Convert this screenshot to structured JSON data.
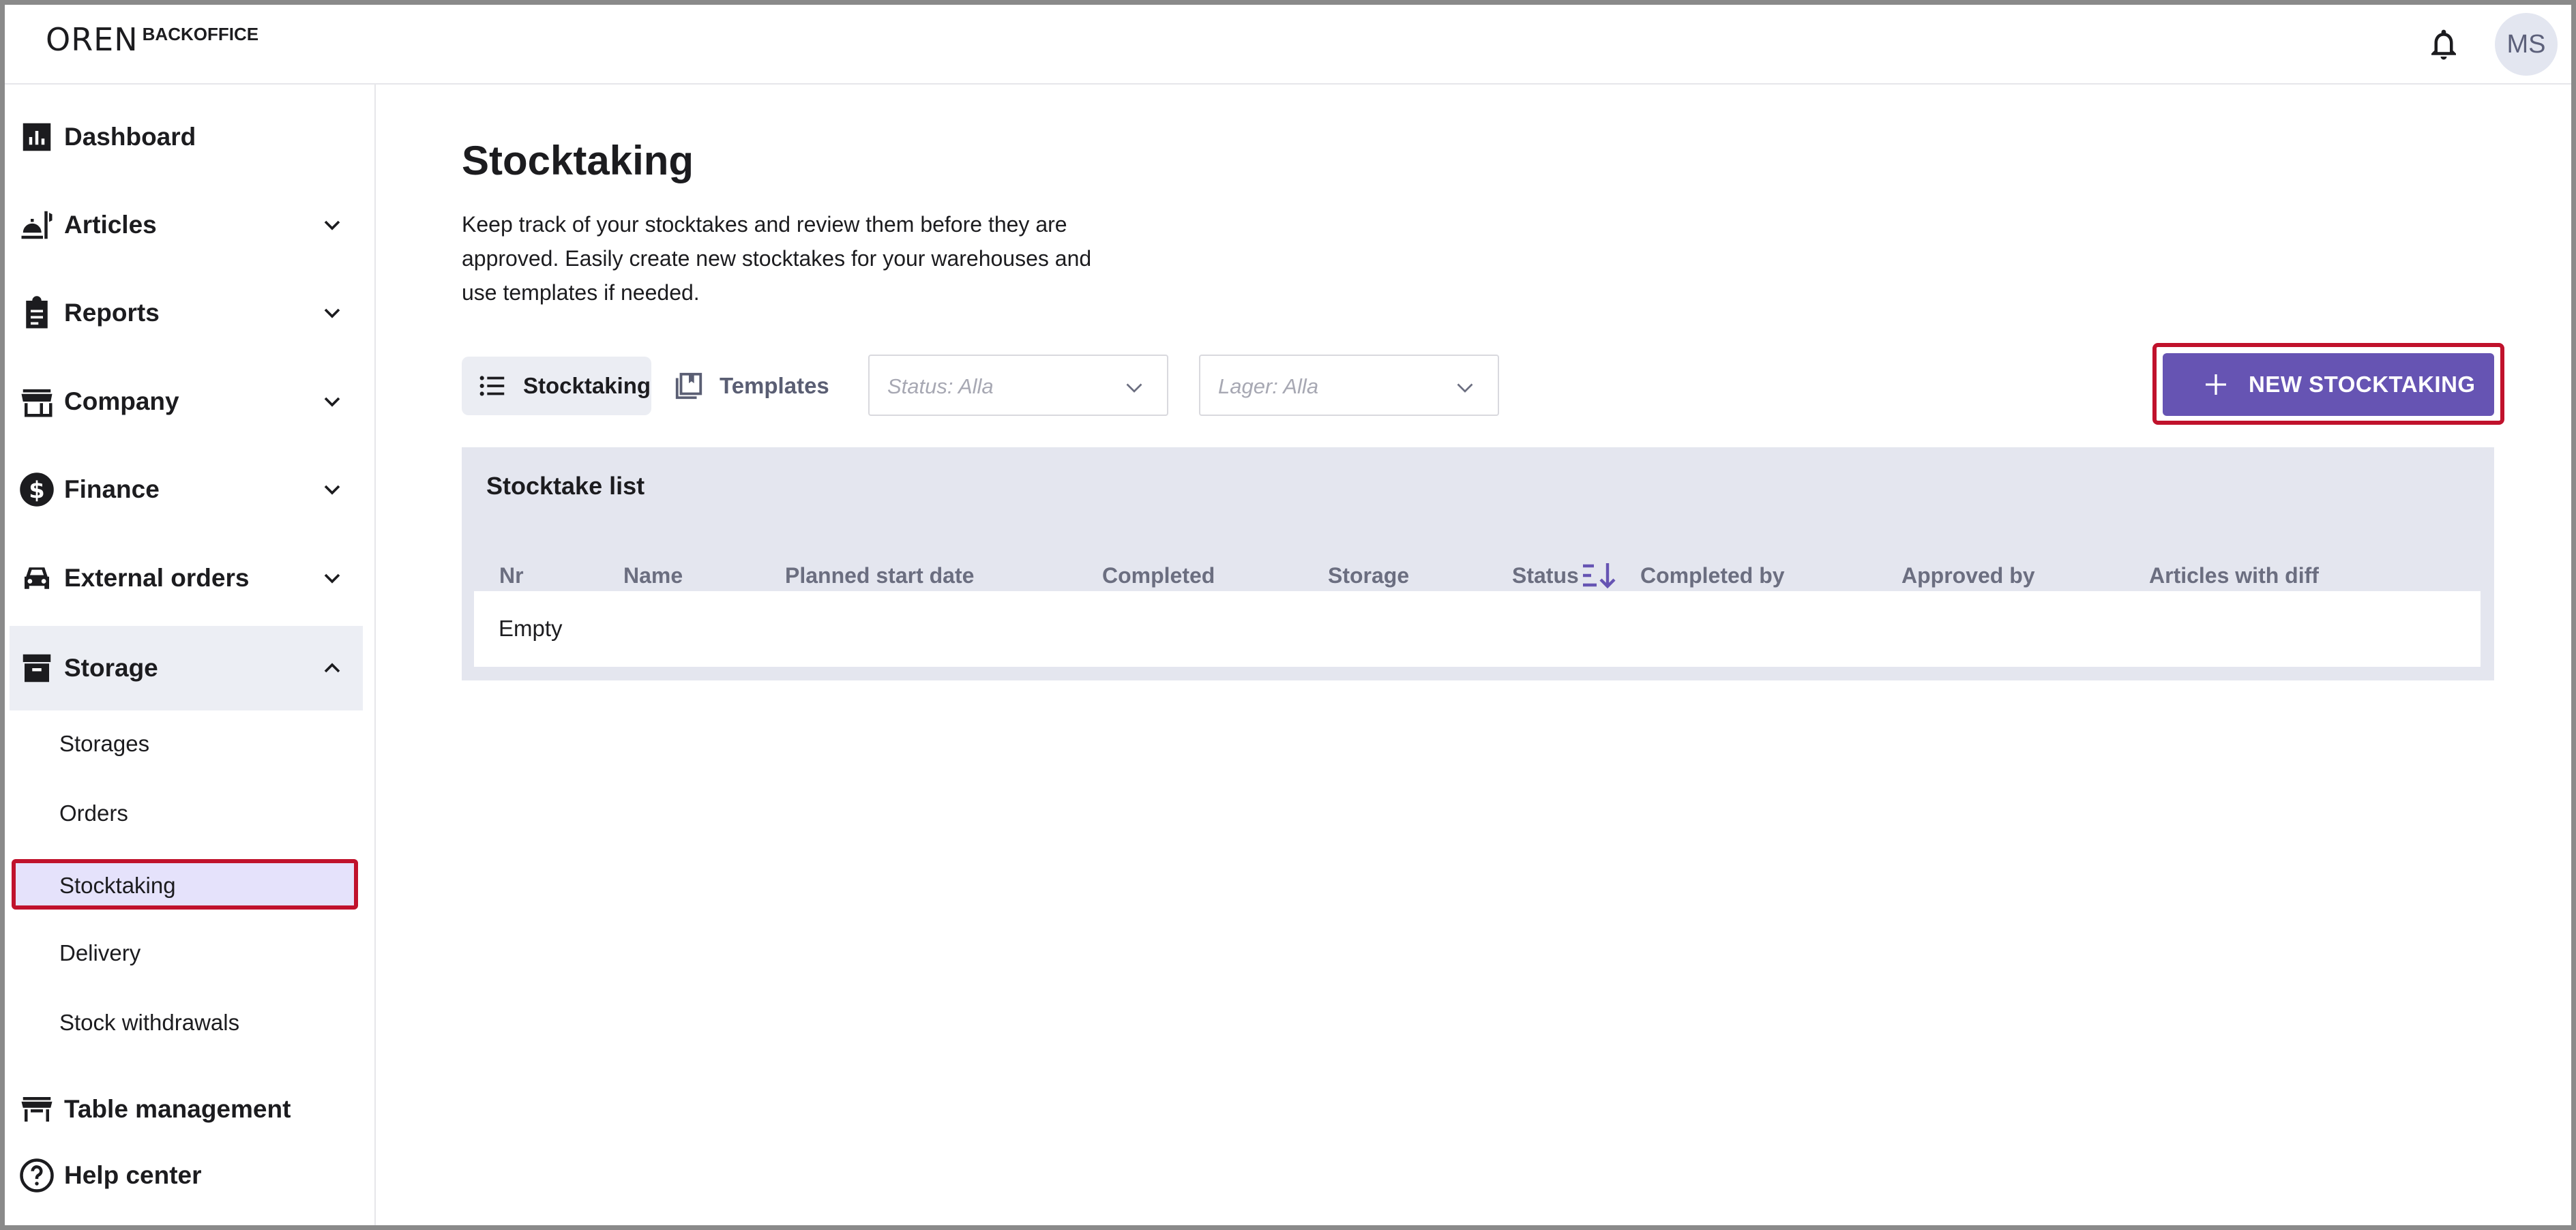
{
  "header": {
    "logo_mark": "OREΝ",
    "logo_text": "BACKOFFICE",
    "avatar_initials": "MS"
  },
  "sidebar": {
    "items": [
      {
        "label": "Dashboard",
        "icon": "bar-chart-icon"
      },
      {
        "label": "Articles",
        "icon": "food-service-icon"
      },
      {
        "label": "Reports",
        "icon": "clipboard-icon"
      },
      {
        "label": "Company",
        "icon": "store-icon"
      },
      {
        "label": "Finance",
        "icon": "dollar-circle-icon"
      },
      {
        "label": "External orders",
        "icon": "car-icon"
      },
      {
        "label": "Storage",
        "icon": "archive-box-icon"
      },
      {
        "label": "Table management",
        "icon": "table-icon"
      },
      {
        "label": "Help center",
        "icon": "help-circle-icon"
      }
    ],
    "storage_sub": [
      "Storages",
      "Orders",
      "Stocktaking",
      "Delivery",
      "Stock withdrawals"
    ]
  },
  "main": {
    "title": "Stocktaking",
    "description": "Keep track of your stocktakes and review them before they are approved. Easily create new stocktakes for your warehouses and use templates if needed.",
    "tabs": [
      "Stocktaking",
      "Templates"
    ],
    "filters": {
      "status_placeholder": "Status: Alla",
      "storage_placeholder": "Lager: Alla"
    },
    "new_button": "NEW STOCKTAKING",
    "table": {
      "title": "Stocktake list",
      "columns": [
        "Nr",
        "Name",
        "Planned start date",
        "Completed",
        "Storage",
        "Status",
        "Completed by",
        "Approved by",
        "Articles with diff"
      ],
      "empty_text": "Empty"
    }
  },
  "colors": {
    "accent": "#6654b3",
    "highlight": "#c0122c",
    "active_sub_bg": "#e5e2fb",
    "panel_bg": "#e4e6ef"
  }
}
